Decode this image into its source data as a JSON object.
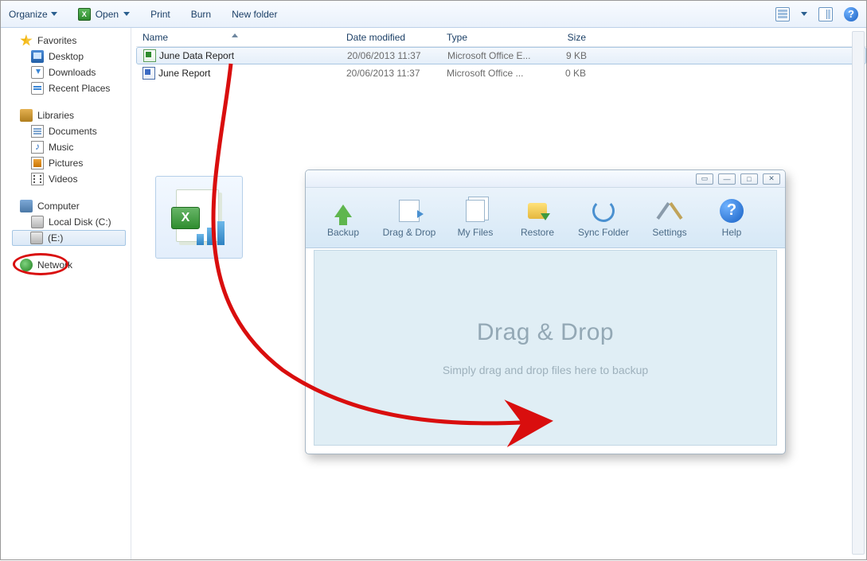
{
  "toolbar": {
    "organize": "Organize",
    "open": "Open",
    "print": "Print",
    "burn": "Burn",
    "new_folder": "New folder"
  },
  "columns": {
    "name": "Name",
    "date": "Date modified",
    "type": "Type",
    "size": "Size"
  },
  "sidebar": {
    "favorites_label": "Favorites",
    "favorites": [
      {
        "label": "Desktop"
      },
      {
        "label": "Downloads"
      },
      {
        "label": "Recent Places"
      }
    ],
    "libraries_label": "Libraries",
    "libraries": [
      {
        "label": "Documents"
      },
      {
        "label": "Music"
      },
      {
        "label": "Pictures"
      },
      {
        "label": "Videos"
      }
    ],
    "computer_label": "Computer",
    "drives": [
      {
        "label": "Local Disk (C:)"
      },
      {
        "label": "(E:)"
      }
    ],
    "network_label": "Network"
  },
  "files": [
    {
      "name": "June Data Report",
      "date": "20/06/2013 11:37",
      "type": "Microsoft Office E...",
      "size": "9 KB"
    },
    {
      "name": "June Report",
      "date": "20/06/2013 11:37",
      "type": "Microsoft Office ...",
      "size": "0 KB"
    }
  ],
  "app": {
    "buttons": {
      "backup": "Backup",
      "dragdrop": "Drag & Drop",
      "myfiles": "My Files",
      "restore": "Restore",
      "sync": "Sync Folder",
      "settings": "Settings",
      "help": "Help"
    },
    "dropzone": {
      "title": "Drag & Drop",
      "subtitle": "Simply drag and drop files here to backup"
    },
    "help_q": "?",
    "win": {
      "min": "—",
      "max": "□",
      "close": "✕",
      "extra": "▭"
    }
  }
}
